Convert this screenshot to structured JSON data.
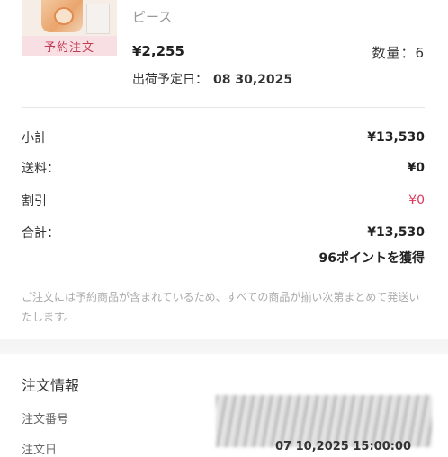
{
  "product": {
    "badge": "予約注文",
    "name": "ピース",
    "price": "¥2,255",
    "quantity": "数量：6",
    "shipping_label": "出荷予定日：",
    "shipping_date": "08 30,2025"
  },
  "summary": {
    "subtotal_label": "小計",
    "subtotal_value": "¥13,530",
    "shipping_label": "送料：",
    "shipping_value": "¥0",
    "discount_label": "割引",
    "discount_value": "¥0",
    "total_label": "合計：",
    "total_value": "¥13,530",
    "points": "96ポイントを獲得"
  },
  "note": "ご注文には予約商品が含まれているため、すべての商品が揃い次第まとめて発送いたします。",
  "order_info": {
    "title": "注文情報",
    "order_number_label": "注文番号",
    "order_date_label": "注文日",
    "order_date_value": "07 10,2025 15:00:00"
  },
  "colors": {
    "badge_bg": "#f8dfe3",
    "badge_text": "#c23c55",
    "discount": "#d8395a"
  }
}
